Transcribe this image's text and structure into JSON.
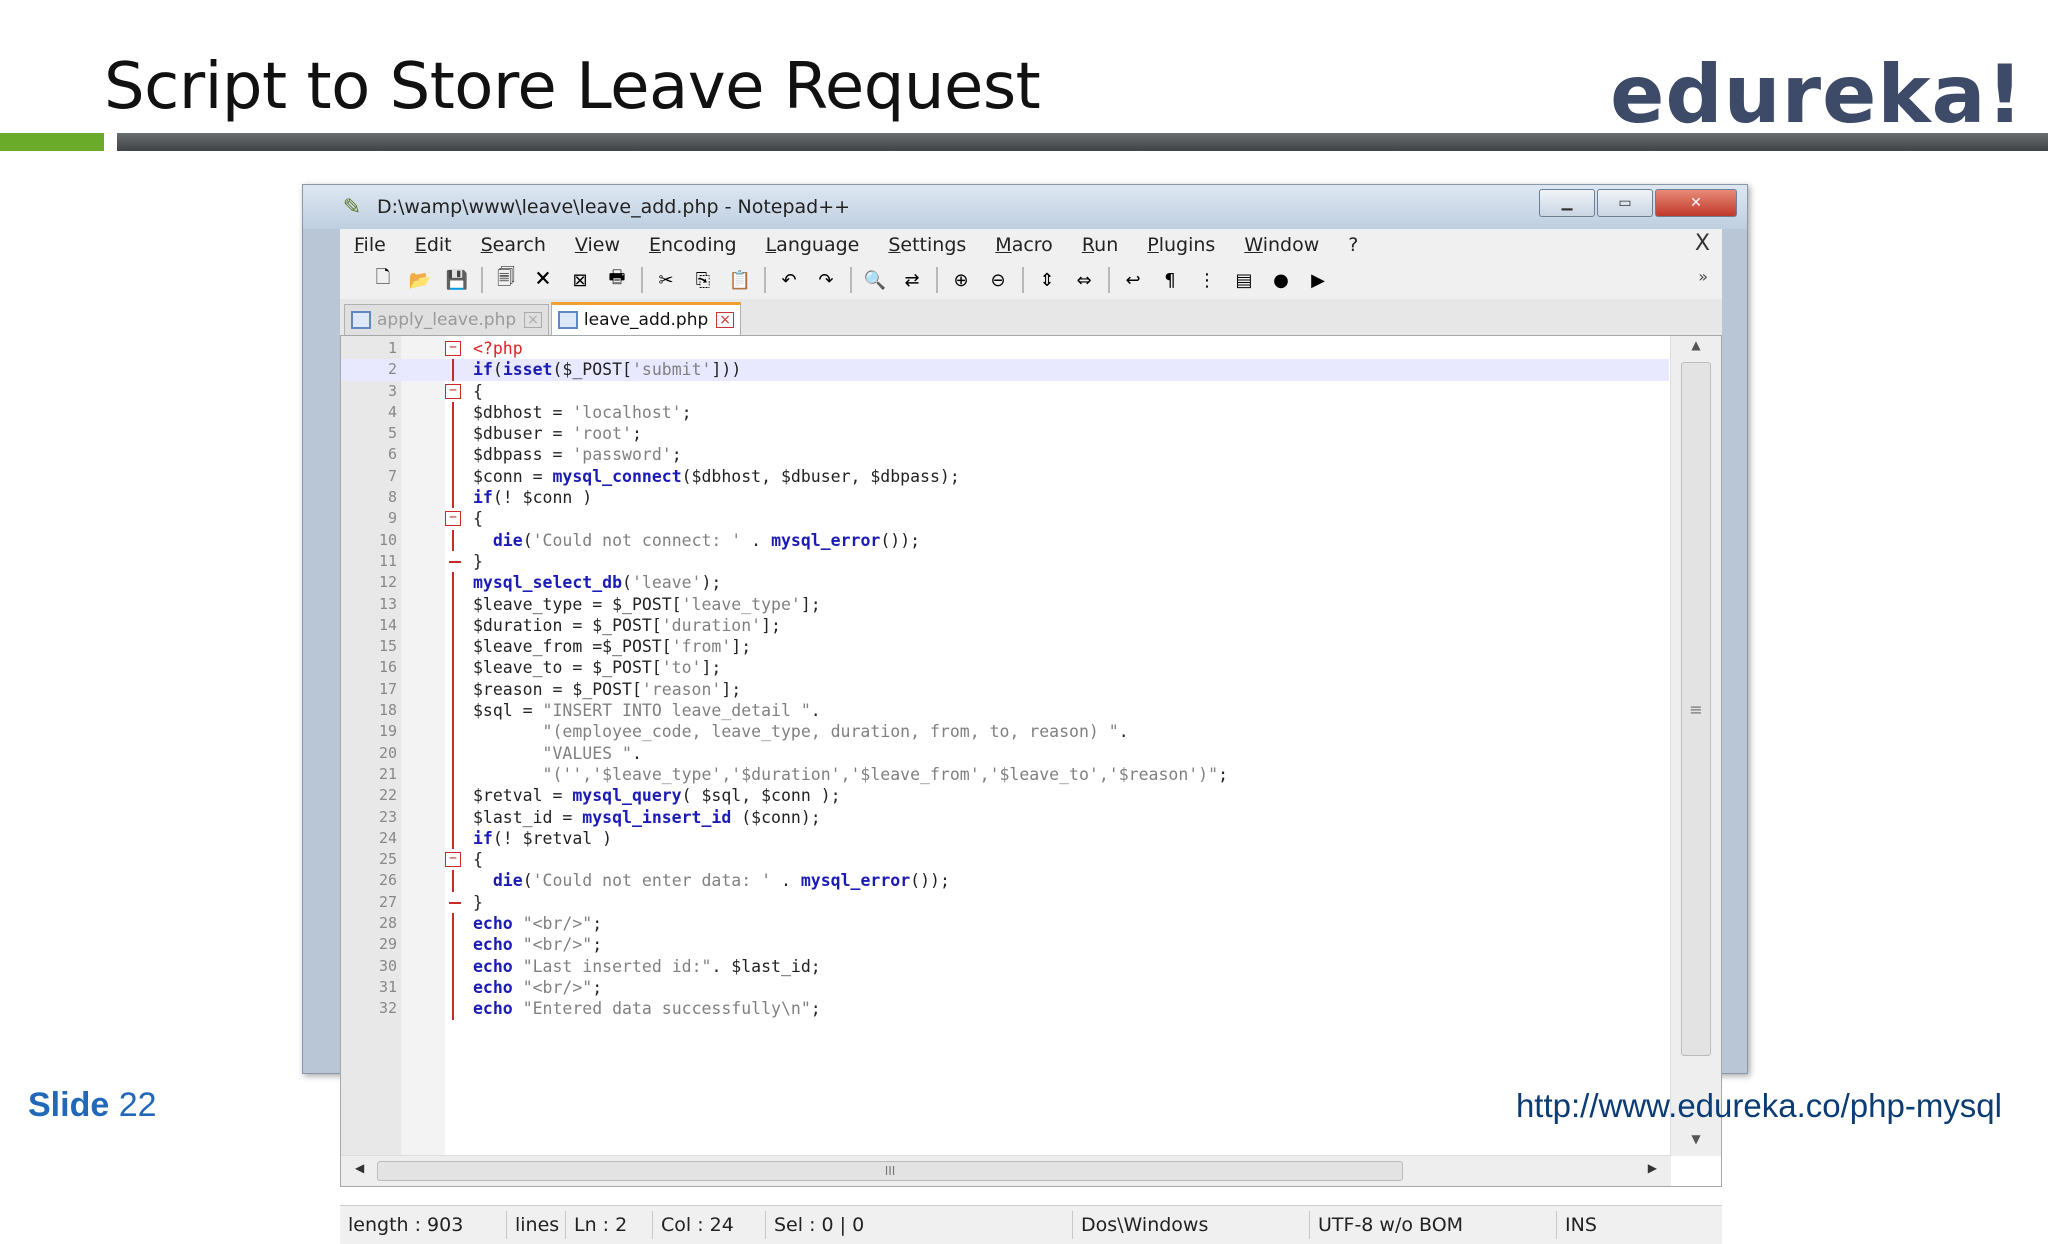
{
  "slide": {
    "title": "Script to Store Leave Request",
    "logo_text": "edureka!",
    "footer_label": "Slide",
    "footer_number": "22",
    "footer_url": "http://www.edureka.co/php-mysql"
  },
  "window": {
    "title": "D:\\wamp\\www\\leave\\leave_add.php - Notepad++",
    "buttons": [
      "minimize",
      "maximize",
      "close"
    ]
  },
  "menu": [
    "File",
    "Edit",
    "Search",
    "View",
    "Encoding",
    "Language",
    "Settings",
    "Macro",
    "Run",
    "Plugins",
    "Window",
    "?"
  ],
  "menu_close": "X",
  "toolbar": {
    "icons": [
      "new-file-icon",
      "open-file-icon",
      "save-icon",
      "save-all-icon",
      "close-icon",
      "close-all-icon",
      "print-icon",
      "cut-icon",
      "copy-icon",
      "paste-icon",
      "undo-icon",
      "redo-icon",
      "find-icon",
      "replace-icon",
      "zoom-in-icon",
      "zoom-out-icon",
      "sync-v-icon",
      "sync-h-icon",
      "wrap-icon",
      "show-all-chars-icon",
      "indent-guide-icon",
      "doc-map-icon",
      "macro-icon",
      "macro-play-icon"
    ],
    "overflow": "»"
  },
  "tabs": [
    {
      "label": "apply_leave.php",
      "active": false
    },
    {
      "label": "leave_add.php",
      "active": true
    }
  ],
  "editor": {
    "current_line": 2,
    "lines": [
      "<?php",
      "if(isset($_POST['submit']))",
      "{",
      "$dbhost = 'localhost';",
      "$dbuser = 'root';",
      "$dbpass = 'password';",
      "$conn = mysql_connect($dbhost, $dbuser, $dbpass);",
      "if(! $conn )",
      "{",
      "  die('Could not connect: ' . mysql_error());",
      "}",
      "mysql_select_db('leave');",
      "$leave_type = $_POST['leave_type'];",
      "$duration = $_POST['duration'];",
      "$leave_from =$_POST['from'];",
      "$leave_to = $_POST['to'];",
      "$reason = $_POST['reason'];",
      "$sql = \"INSERT INTO leave_detail \".",
      "       \"(employee_code, leave_type, duration, from, to, reason) \".",
      "       \"VALUES \".",
      "       \"('','$leave_type','$duration','$leave_from','$leave_to','$reason')\";",
      "$retval = mysql_query( $sql, $conn );",
      "$last_id = mysql_insert_id ($conn);",
      "if(! $retval )",
      "{",
      "  die('Could not enter data: ' . mysql_error());",
      "}",
      "echo \"<br/>\";",
      "echo \"<br/>\";",
      "echo \"Last inserted id:\". $last_id;",
      "echo \"<br/>\";",
      "echo \"Entered data successfully\\n\";"
    ],
    "fold_open_lines": [
      1,
      3,
      9,
      25
    ],
    "fold_close_lines": [
      11,
      27
    ],
    "scroll_v_thumb": "≡",
    "scroll_h_thumb": "III"
  },
  "status": {
    "length": "length : 903",
    "lines": "lines",
    "ln": "Ln : 2",
    "col": "Col : 24",
    "sel": "Sel : 0 | 0",
    "eol": "Dos\\Windows",
    "encoding": "UTF-8 w/o BOM",
    "mode": "INS"
  },
  "colors": {
    "accent_green": "#6aab2a",
    "brand_blue": "#2268b8",
    "url_navy": "#0b3d74",
    "keyword_blue": "#1b1bb5",
    "fold_red": "#c82a2a"
  }
}
